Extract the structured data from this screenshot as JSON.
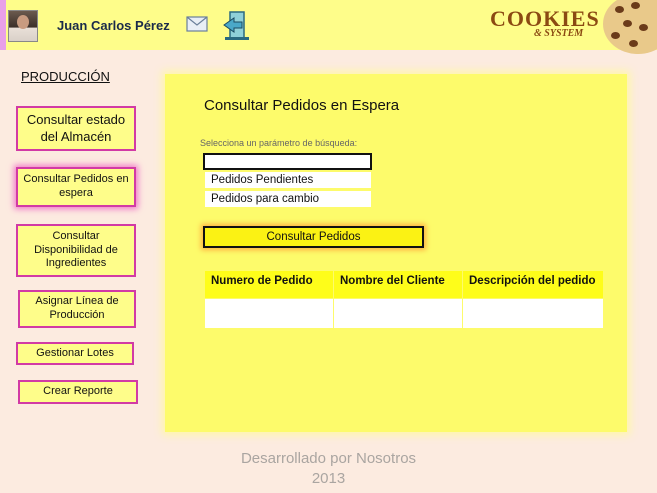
{
  "header": {
    "user_name": "Juan Carlos Pérez",
    "mail_icon": "mail-icon",
    "exit_icon": "logout-icon",
    "logo_main": "COOKIES",
    "logo_sub": "& SYSTEM"
  },
  "sidebar": {
    "section_title": "PRODUCCIÓN",
    "items": [
      {
        "label": "Consultar estado del Almacén"
      },
      {
        "label": "Consultar Pedidos en espera"
      },
      {
        "label": "Consultar Disponibilidad de Ingredientes"
      },
      {
        "label": "Asignar Línea de Producción"
      },
      {
        "label": "Gestionar Lotes"
      },
      {
        "label": "Crear Reporte"
      }
    ]
  },
  "main": {
    "title": "Consultar Pedidos en Espera",
    "param_label": "Selecciona un parámetro de búsqueda:",
    "search_value": "",
    "options": [
      "Pedidos Pendientes",
      "Pedidos para cambio"
    ],
    "consult_button": "Consultar Pedidos",
    "table": {
      "headers": [
        "Numero de Pedido",
        "Nombre del Cliente",
        "Descripción del pedido"
      ],
      "rows": [
        [
          "",
          "",
          ""
        ]
      ]
    }
  },
  "footer": {
    "line1": "Desarrollado por Nosotros",
    "line2": "2013"
  },
  "colors": {
    "header_bg": "#fefd8a",
    "panel_bg": "#fdfb6b",
    "nav_border": "#d23aa5",
    "page_bg": "#fcebe0"
  }
}
